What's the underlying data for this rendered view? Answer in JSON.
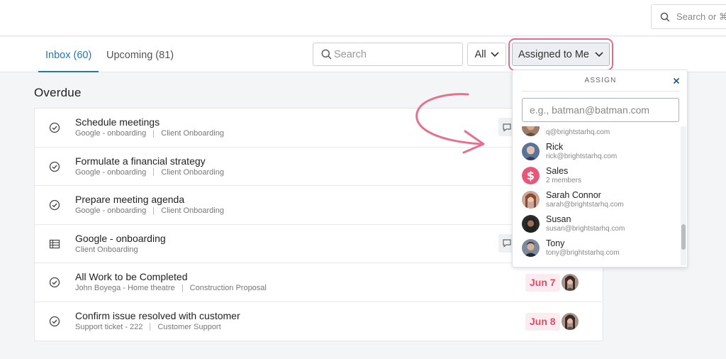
{
  "topbar": {
    "search_placeholder": "Search or ⌘+K",
    "search_icon": "search-icon"
  },
  "tabs": [
    {
      "label": "Inbox (60)",
      "active": true
    },
    {
      "label": "Upcoming (81)",
      "active": false
    }
  ],
  "toolbar": {
    "search_placeholder": "Search",
    "filter_all_label": "All",
    "assign_filter_label": "Assigned to Me"
  },
  "section": {
    "title": "Overdue"
  },
  "tasks": [
    {
      "title": "Schedule meetings",
      "meta1": "Google - onboarding",
      "meta2": "Client Onboarding",
      "icon": "check-circle-icon",
      "comment": true
    },
    {
      "title": "Formulate a financial strategy",
      "meta1": "Google - onboarding",
      "meta2": "Client Onboarding",
      "icon": "check-circle-icon"
    },
    {
      "title": "Prepare meeting agenda",
      "meta1": "Google - onboarding",
      "meta2": "Client Onboarding",
      "icon": "check-circle-icon"
    },
    {
      "title": "Google - onboarding",
      "meta1": "Client Onboarding",
      "icon": "table-icon",
      "comment": true
    },
    {
      "title": "All Work to be Completed",
      "meta1": "John Boyega - Home theatre",
      "meta2": "Construction Proposal",
      "icon": "check-circle-icon",
      "due": "Jun 7"
    },
    {
      "title": "Confirm issue resolved with customer",
      "meta1": "Support ticket - 222",
      "meta2": "Customer Support",
      "icon": "check-circle-icon",
      "due": "Jun 8"
    }
  ],
  "assign_panel": {
    "header": "ASSIGN",
    "input_placeholder": "e.g., batman@batman.com",
    "users": [
      {
        "name": "",
        "sub": "q@brightstarhq.com"
      },
      {
        "name": "Rick",
        "sub": "rick@brightstarhq.com"
      },
      {
        "name": "Sales",
        "sub": "2 members"
      },
      {
        "name": "Sarah Connor",
        "sub": "sarah@brightstarhq.com"
      },
      {
        "name": "Susan",
        "sub": "susan@brightstarhq.com"
      },
      {
        "name": "Tony",
        "sub": "tony@brightstarhq.com"
      }
    ]
  },
  "colors": {
    "accent": "#1a7ab7",
    "highlight": "#e26b8d",
    "due": "#e04b6a"
  }
}
